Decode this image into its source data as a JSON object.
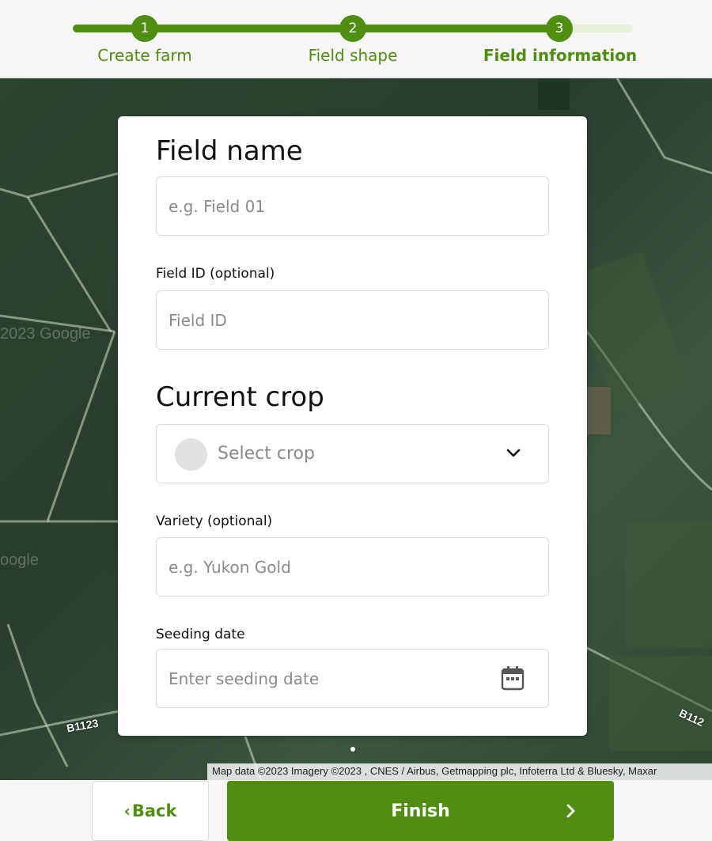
{
  "stepper": {
    "steps": [
      {
        "number": "1",
        "label": "Create farm"
      },
      {
        "number": "2",
        "label": "Field shape"
      },
      {
        "number": "3",
        "label": "Field information"
      }
    ],
    "current_step": 3
  },
  "map": {
    "attribution": "Map data ©2023 Imagery ©2023 , CNES / Airbus, Getmapping plc, Infoterra Ltd & Bluesky, Maxar",
    "watermarks": [
      "2023 Google",
      "oogle"
    ],
    "road_labels": [
      "B1123",
      "B112"
    ]
  },
  "form": {
    "field_name": {
      "heading": "Field name",
      "placeholder": "e.g. Field 01",
      "value": ""
    },
    "field_id": {
      "label": "Field ID (optional)",
      "placeholder": "Field ID",
      "value": ""
    },
    "current_crop": {
      "heading": "Current crop",
      "placeholder": "Select crop",
      "icon": "chevron-down-icon"
    },
    "variety": {
      "label": "Variety (optional)",
      "placeholder": "e.g. Yukon Gold",
      "value": ""
    },
    "seeding_date": {
      "label": "Seeding date",
      "placeholder": "Enter seeding date",
      "icon": "calendar-icon"
    }
  },
  "actions": {
    "back_label": "Back",
    "finish_label": "Finish"
  },
  "colors": {
    "accent": "#4f8e10",
    "accent_light": "#e6f1dc",
    "placeholder": "#8a8a8a"
  }
}
